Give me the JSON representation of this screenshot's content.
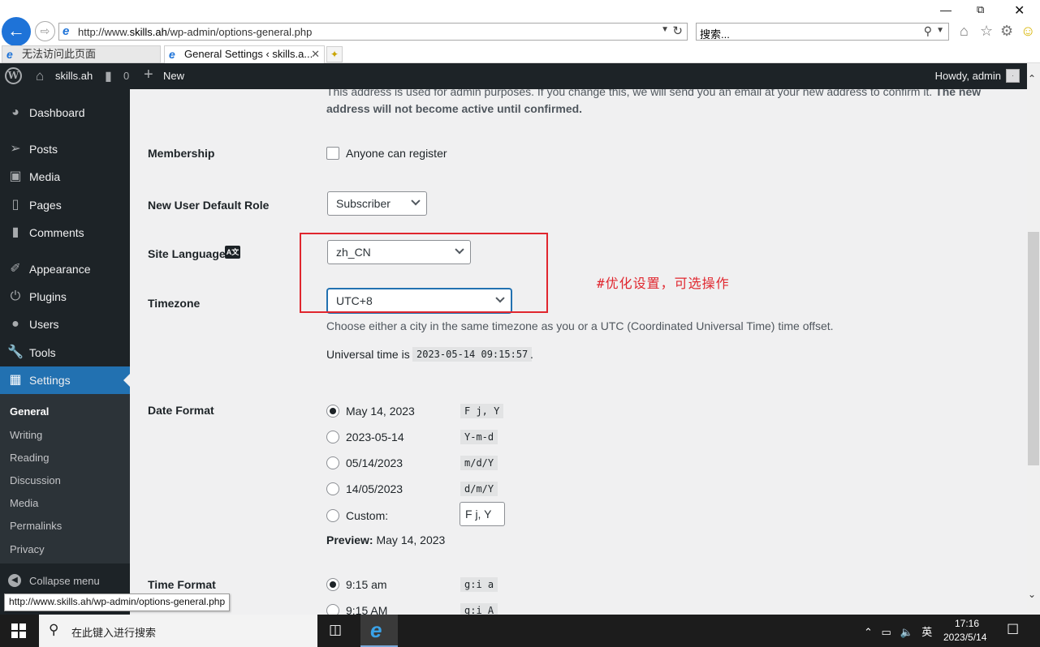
{
  "browser": {
    "url_prefix": "http://www.",
    "url_host": "skills.ah",
    "url_path": "/wp-admin/options-general.php",
    "search_text": "搜索...",
    "tabs": [
      {
        "label": "无法访问此页面"
      },
      {
        "label": "General Settings ‹ skills.a..."
      }
    ],
    "status_url": "http://www.skills.ah/wp-admin/options-general.php"
  },
  "admin_bar": {
    "site_name": "skills.ah",
    "comment_count": "0",
    "new_label": "New",
    "howdy": "Howdy, admin"
  },
  "sidebar": {
    "items": [
      {
        "label": "Dashboard",
        "icon": "dashboard-icon"
      },
      {
        "label": "Posts",
        "icon": "pin-icon"
      },
      {
        "label": "Media",
        "icon": "media-icon"
      },
      {
        "label": "Pages",
        "icon": "pages-icon"
      },
      {
        "label": "Comments",
        "icon": "comment-icon"
      },
      {
        "label": "Appearance",
        "icon": "brush-icon"
      },
      {
        "label": "Plugins",
        "icon": "plug-icon"
      },
      {
        "label": "Users",
        "icon": "user-icon"
      },
      {
        "label": "Tools",
        "icon": "wrench-icon"
      },
      {
        "label": "Settings",
        "icon": "settings-icon"
      }
    ],
    "submenu": [
      "General",
      "Writing",
      "Reading",
      "Discussion",
      "Media",
      "Permalinks",
      "Privacy"
    ],
    "collapse_label": "Collapse menu"
  },
  "content": {
    "email_desc_normal": "This address is used for admin purposes. If you change this, we will send you an email at your new address to confirm it.",
    "email_desc_bold_1": "The new",
    "email_desc_bold_2": "address will not become active until confirmed.",
    "membership": {
      "label": "Membership",
      "checkbox_label": "Anyone can register",
      "checked": false
    },
    "default_role": {
      "label": "New User Default Role",
      "value": "Subscriber"
    },
    "site_language": {
      "label": "Site Language",
      "value": "zh_CN"
    },
    "timezone": {
      "label": "Timezone",
      "value": "UTC+8",
      "desc": "Choose either a city in the same timezone as you or a UTC (Coordinated Universal Time) time offset.",
      "universal_label": "Universal time is",
      "universal_value": "2023-05-14 09:15:57",
      "universal_suffix": "."
    },
    "annotation": "#优化设置，可选操作",
    "date_format": {
      "label": "Date Format",
      "options": [
        {
          "label": "May 14, 2023",
          "code": "F j, Y",
          "checked": true
        },
        {
          "label": "2023-05-14",
          "code": "Y-m-d",
          "checked": false
        },
        {
          "label": "05/14/2023",
          "code": "m/d/Y",
          "checked": false
        },
        {
          "label": "14/05/2023",
          "code": "d/m/Y",
          "checked": false
        }
      ],
      "custom_label": "Custom:",
      "custom_value": "F j, Y",
      "preview_label": "Preview:",
      "preview_value": "May 14, 2023"
    },
    "time_format": {
      "label": "Time Format",
      "options": [
        {
          "label": "9:15 am",
          "code": "g:i a",
          "checked": true
        },
        {
          "label": "9:15 AM",
          "code": "g:i A",
          "checked": false
        }
      ]
    }
  },
  "taskbar": {
    "search_placeholder": "在此键入进行搜索",
    "ime": "英",
    "time": "17:16",
    "date": "2023/5/14"
  }
}
